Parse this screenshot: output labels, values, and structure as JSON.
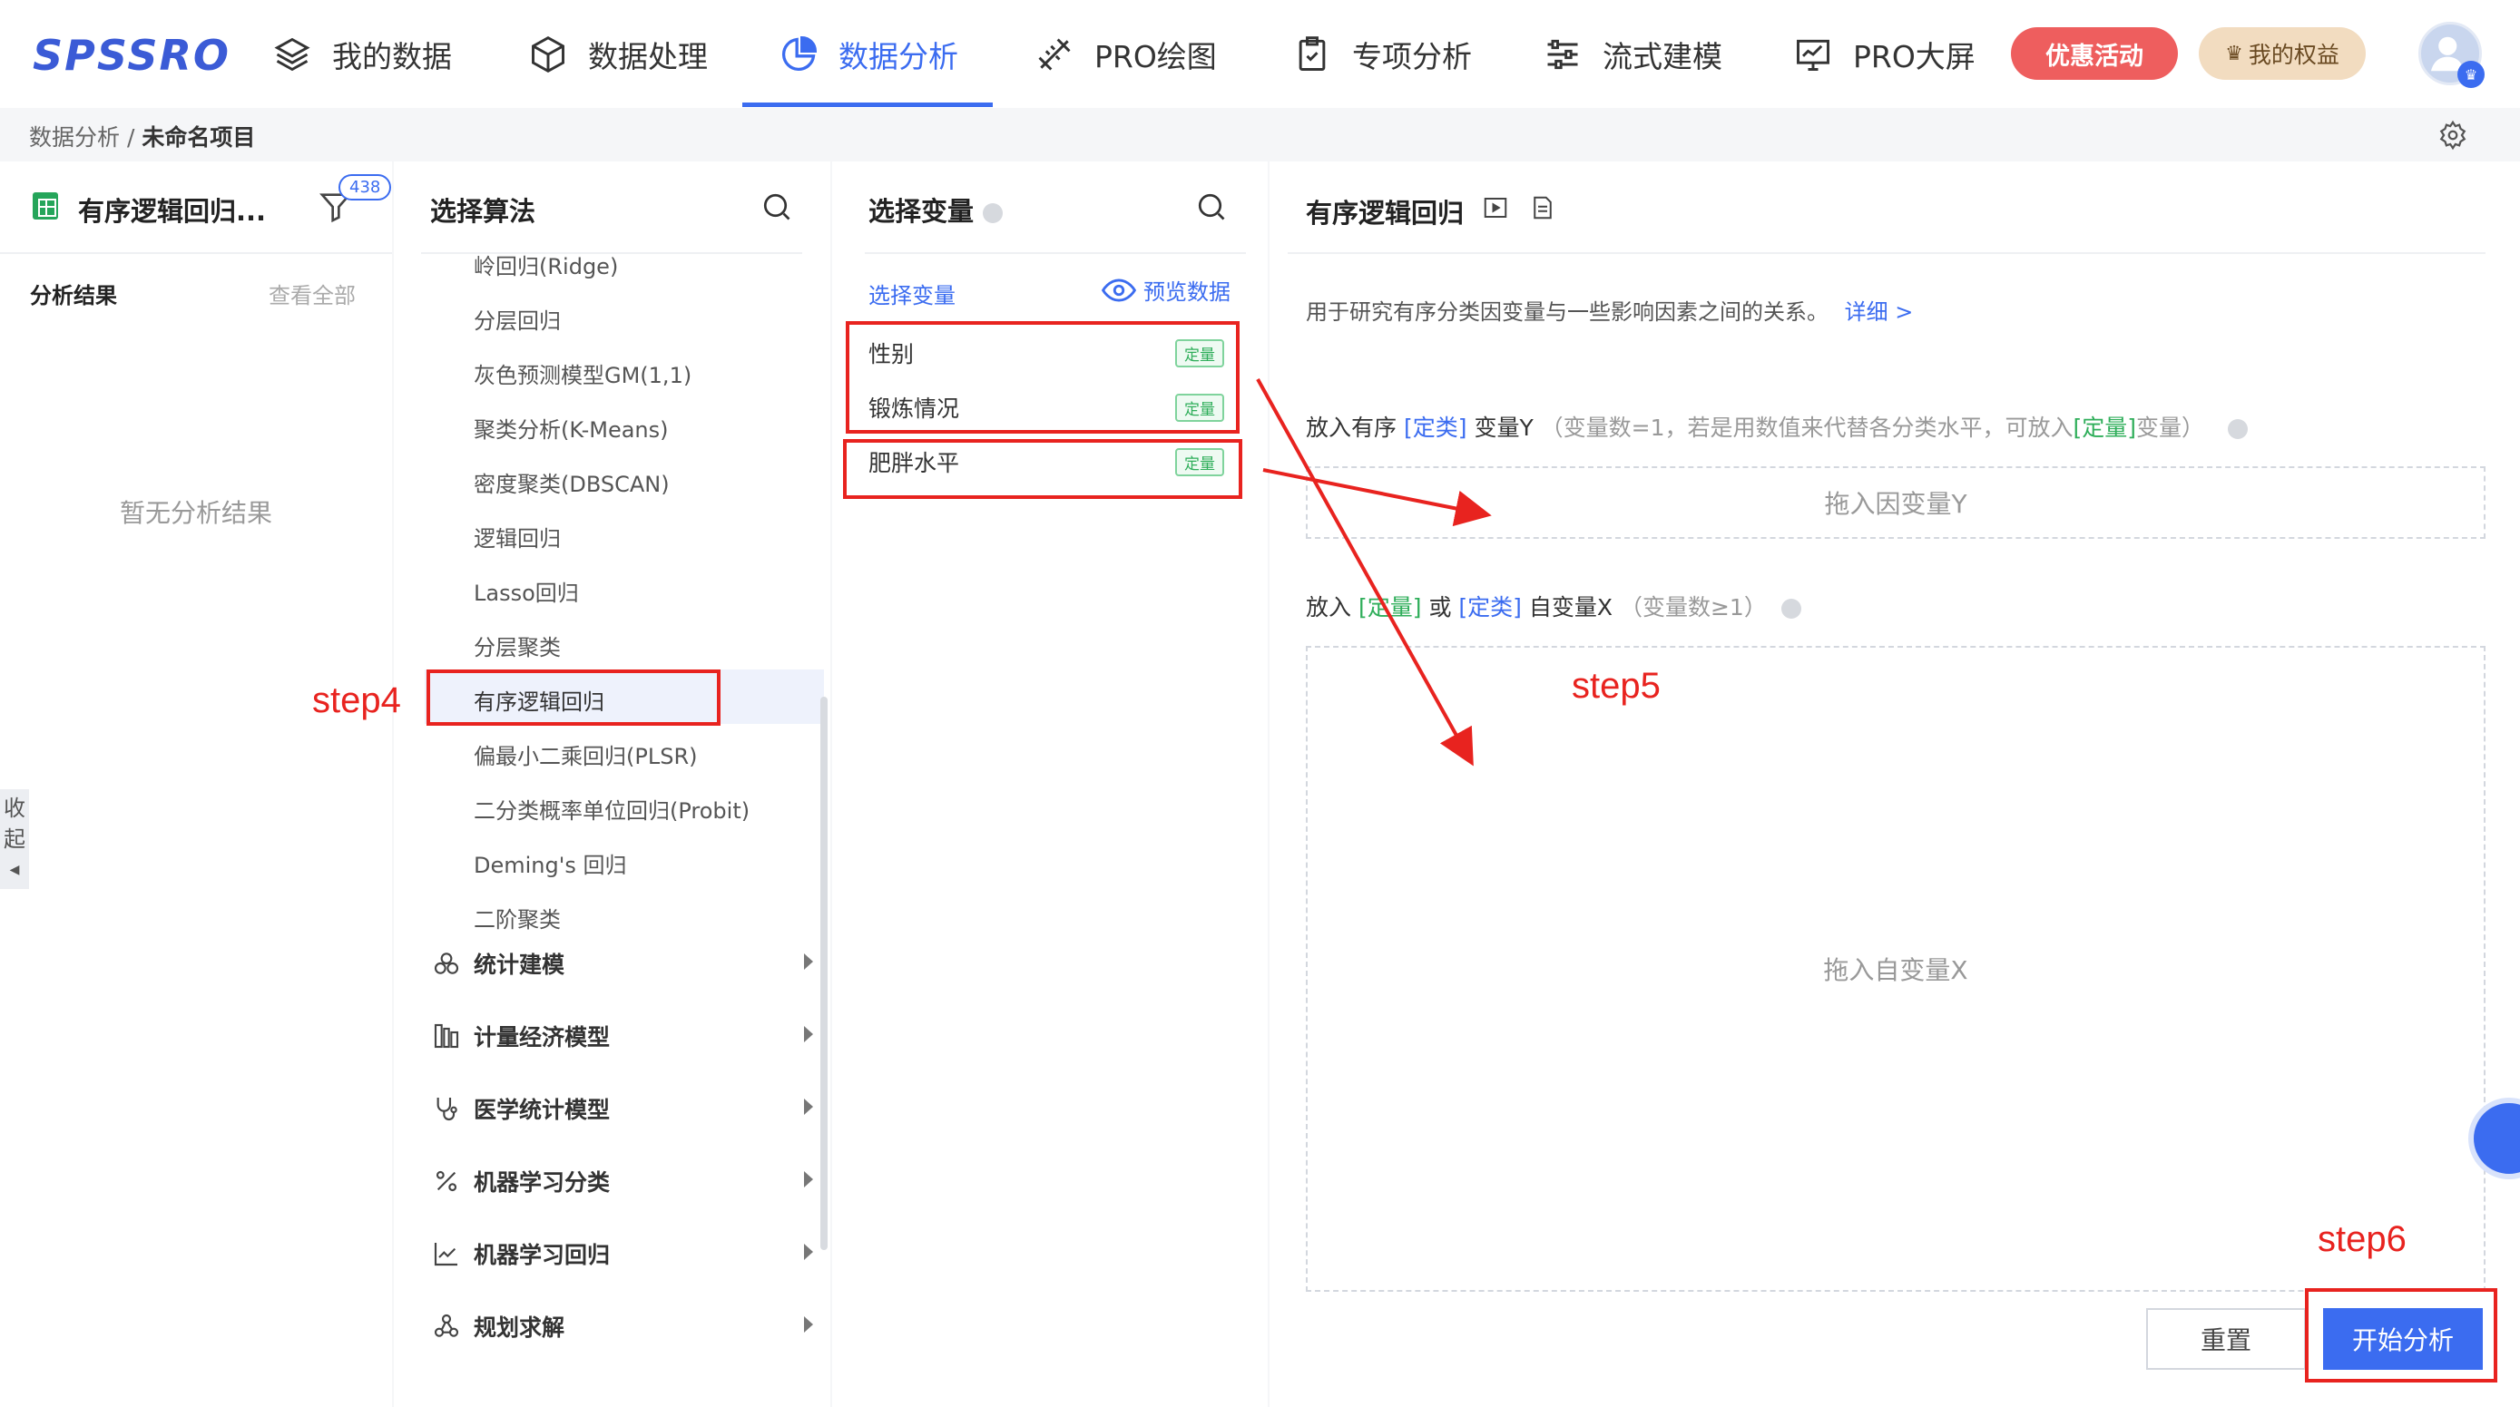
{
  "header": {
    "logo": "SPSSRO",
    "nav": [
      {
        "label": "我的数据",
        "icon": "layers-icon"
      },
      {
        "label": "数据处理",
        "icon": "cube-icon"
      },
      {
        "label": "数据分析",
        "icon": "pie-chart-icon",
        "active": true
      },
      {
        "label": "PRO绘图",
        "icon": "ruler-pencil-icon"
      },
      {
        "label": "专项分析",
        "icon": "clipboard-check-icon"
      },
      {
        "label": "流式建模",
        "icon": "sliders-icon"
      },
      {
        "label": "PRO大屏",
        "icon": "monitor-chart-icon"
      }
    ],
    "promo_label": "优惠活动",
    "rights_label": "我的权益"
  },
  "breadcrumb": {
    "parent": "数据分析",
    "separator": "/",
    "current": "未命名项目"
  },
  "left_panel": {
    "project_title": "有序逻辑回归...",
    "filter_count": "438",
    "results_label": "分析结果",
    "view_all": "查看全部",
    "empty_text": "暂无分析结果",
    "collapse_label_1": "收",
    "collapse_label_2": "起"
  },
  "algo_panel": {
    "title": "选择算法",
    "items": [
      "岭回归(Ridge)",
      "分层回归",
      "灰色预测模型GM(1,1)",
      "聚类分析(K-Means)",
      "密度聚类(DBSCAN)",
      "逻辑回归",
      "Lasso回归",
      "分层聚类",
      "有序逻辑回归",
      "偏最小二乘回归(PLSR)",
      "二分类概率单位回归(Probit)",
      "Deming's 回归",
      "二阶聚类"
    ],
    "selected_index": 8,
    "categories": [
      {
        "label": "统计建模",
        "icon": "three-circles-icon"
      },
      {
        "label": "计量经济模型",
        "icon": "bars-icon"
      },
      {
        "label": "医学统计模型",
        "icon": "stethoscope-icon"
      },
      {
        "label": "机器学习分类",
        "icon": "percent-icon"
      },
      {
        "label": "机器学习回归",
        "icon": "line-chart-icon"
      },
      {
        "label": "规划求解",
        "icon": "graph-icon"
      }
    ]
  },
  "var_panel": {
    "title": "选择变量",
    "sub_label": "选择变量",
    "preview_label": "预览数据",
    "variables": [
      {
        "name": "性别",
        "tag": "定量"
      },
      {
        "name": "锻炼情况",
        "tag": "定量"
      },
      {
        "name": "肥胖水平",
        "tag": "定量"
      }
    ]
  },
  "config_panel": {
    "title": "有序逻辑回归",
    "description": "用于研究有序分类因变量与一些影响因素之间的关系。",
    "detail_link": "详细 >",
    "y_rule": {
      "prefix": "放入有序",
      "type1": "[定类]",
      "middle": "变量Y",
      "note_start": "（变量数=1，若是用数值来代替各分类水平，可放入",
      "type2": "[定量]",
      "note_end": "变量）"
    },
    "x_rule": {
      "prefix": "放入",
      "type1": "[定量]",
      "or": "或",
      "type2": "[定类]",
      "middle": "自变量X",
      "note": "（变量数≥1）"
    },
    "y_drop": "拖入因变量Y",
    "x_drop": "拖入自变量X",
    "reset_label": "重置",
    "start_label": "开始分析"
  },
  "annotations": {
    "step4": "step4",
    "step5": "step5",
    "step6": "step6",
    "color": "#e8231f"
  },
  "colors": {
    "primary": "#3b6cf0",
    "promo": "#ee5e5e",
    "tag_green": "#2fae5a"
  }
}
